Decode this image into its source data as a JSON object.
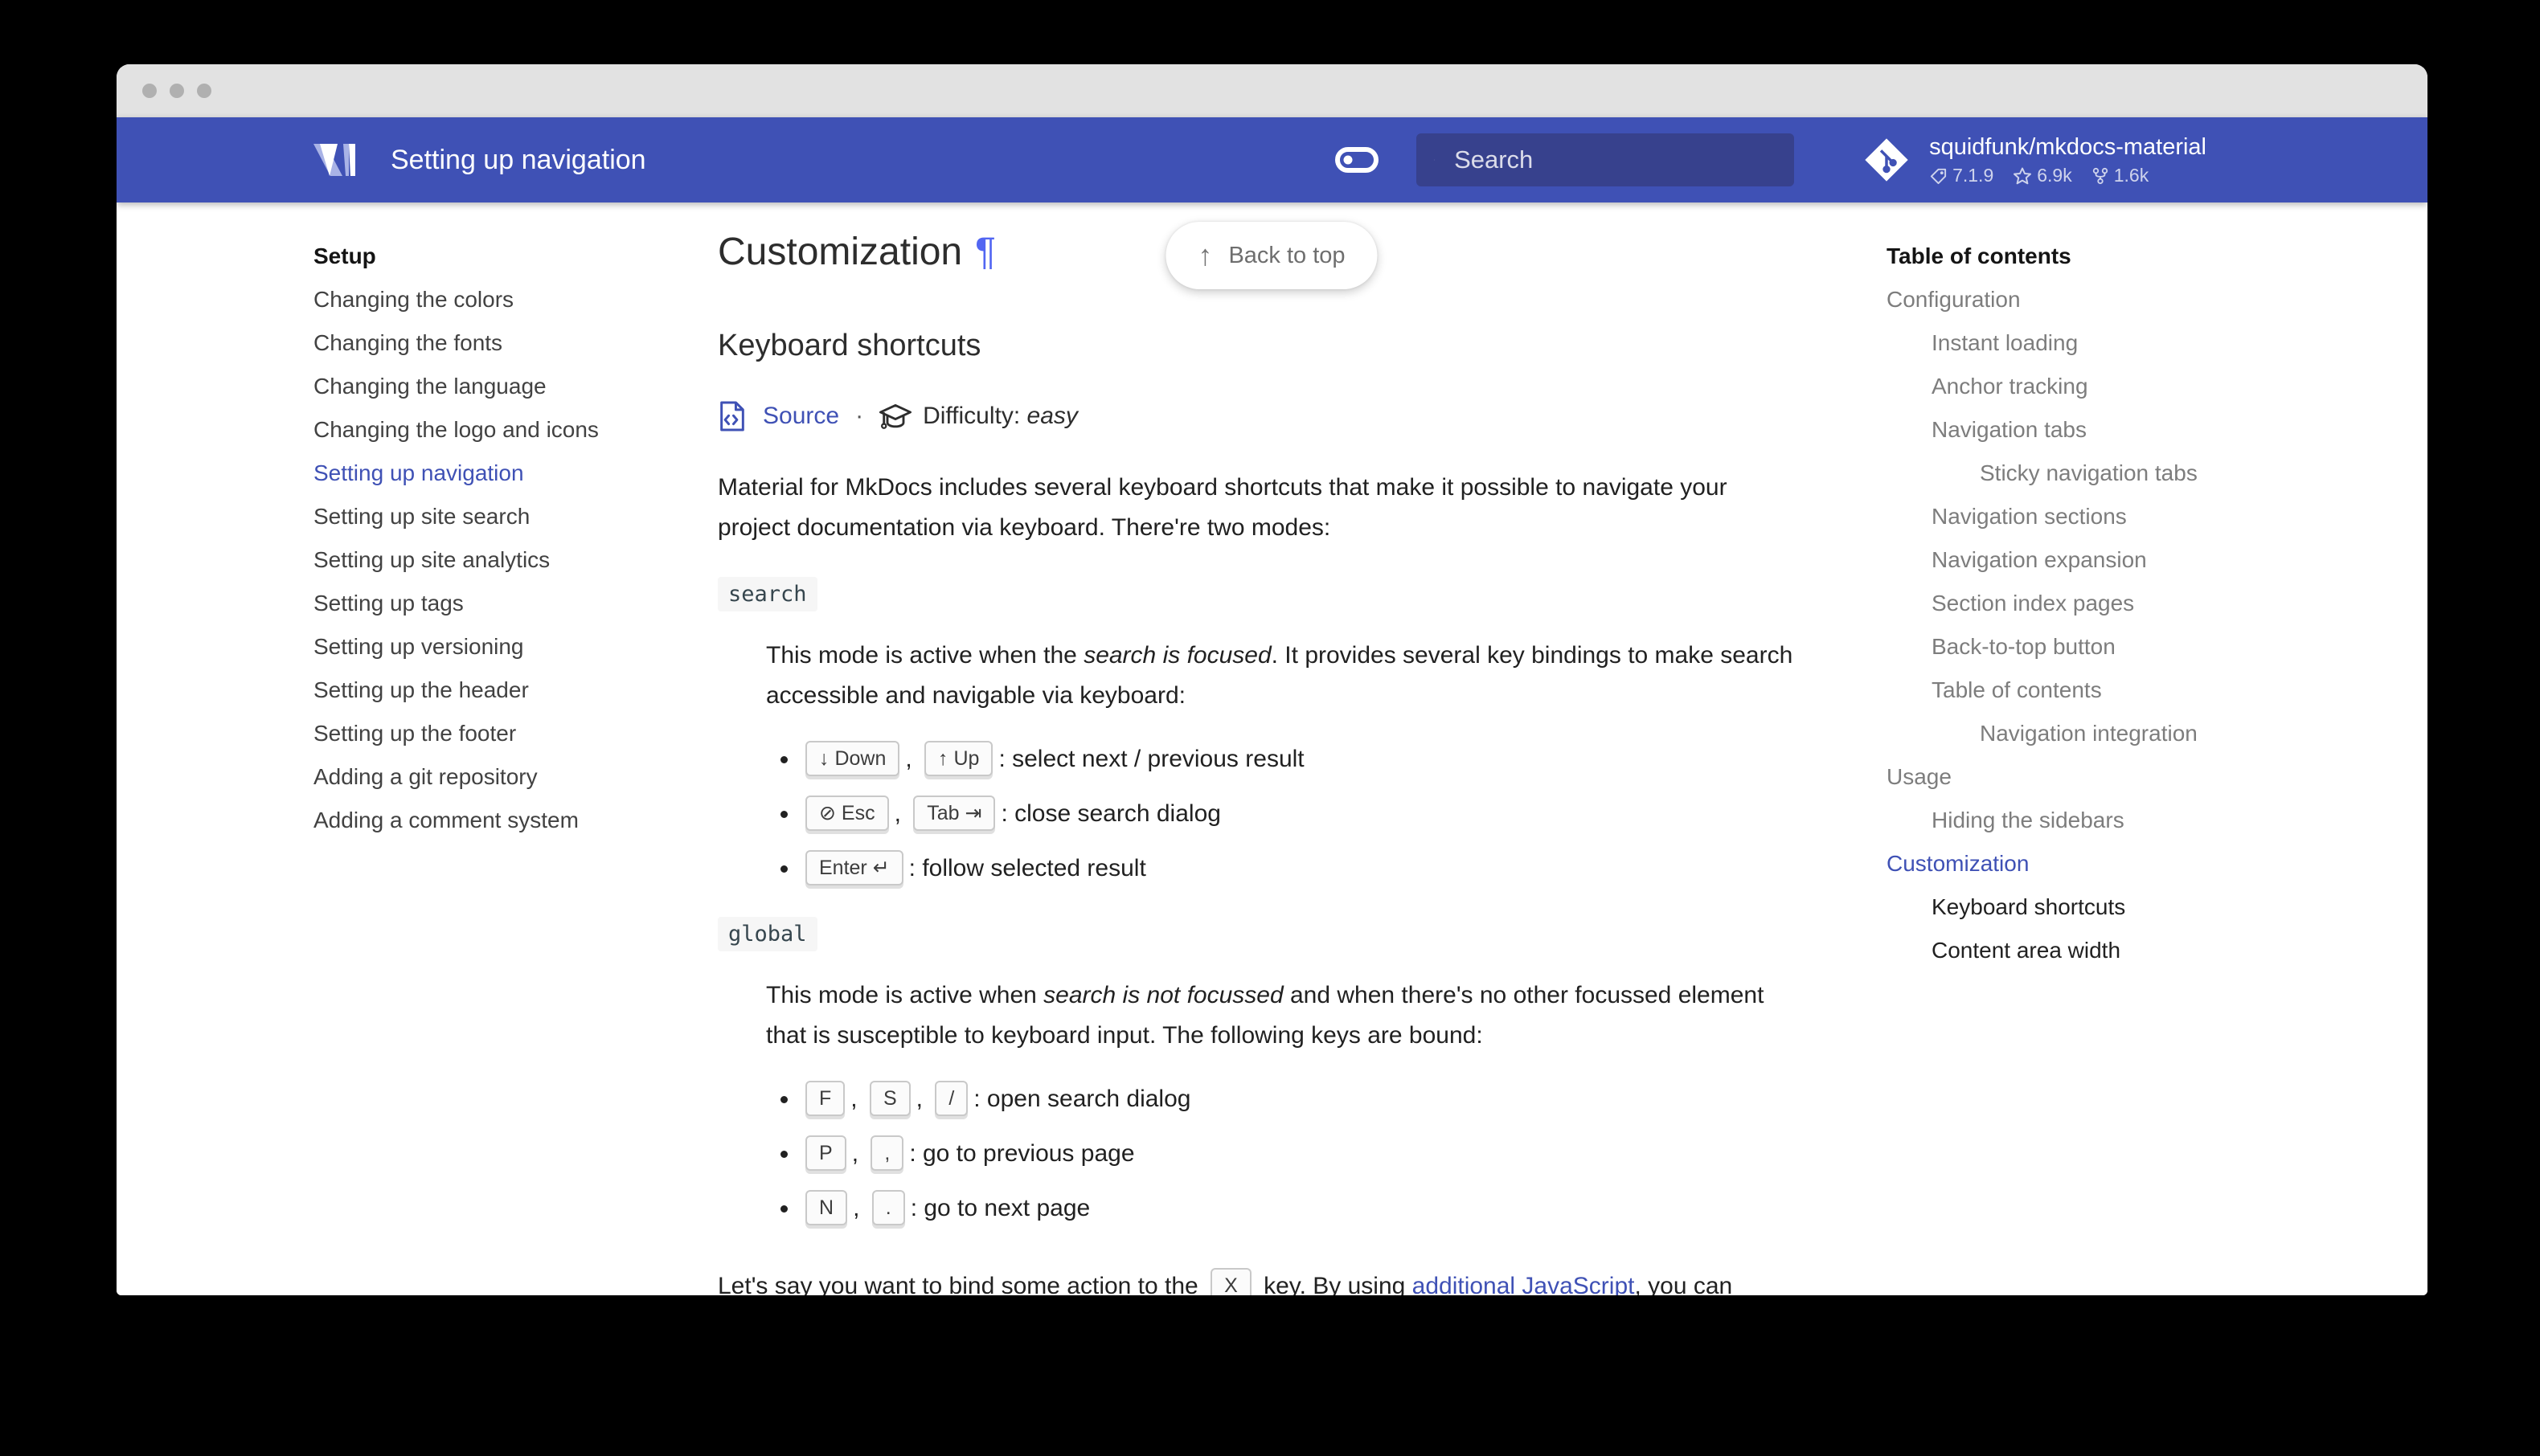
{
  "window": {
    "controls": [
      "dot",
      "dot",
      "dot"
    ]
  },
  "header": {
    "title": "Setting up navigation",
    "search": {
      "placeholder": "Search"
    },
    "repo": {
      "name": "squidfunk/mkdocs-material",
      "version": "7.1.9",
      "stars": "6.9k",
      "forks": "1.6k"
    }
  },
  "sidebar": {
    "section_label": "Setup",
    "items": [
      {
        "label": "Changing the colors",
        "active": false
      },
      {
        "label": "Changing the fonts",
        "active": false
      },
      {
        "label": "Changing the language",
        "active": false
      },
      {
        "label": "Changing the logo and icons",
        "active": false
      },
      {
        "label": "Setting up navigation",
        "active": true
      },
      {
        "label": "Setting up site search",
        "active": false
      },
      {
        "label": "Setting up site analytics",
        "active": false
      },
      {
        "label": "Setting up tags",
        "active": false
      },
      {
        "label": "Setting up versioning",
        "active": false
      },
      {
        "label": "Setting up the header",
        "active": false
      },
      {
        "label": "Setting up the footer",
        "active": false
      },
      {
        "label": "Adding a git repository",
        "active": false
      },
      {
        "label": "Adding a comment system",
        "active": false
      }
    ]
  },
  "toc": {
    "title": "Table of contents",
    "items": [
      {
        "label": "Configuration",
        "level": 0,
        "state": "normal"
      },
      {
        "label": "Instant loading",
        "level": 1,
        "state": "normal"
      },
      {
        "label": "Anchor tracking",
        "level": 1,
        "state": "normal"
      },
      {
        "label": "Navigation tabs",
        "level": 1,
        "state": "normal"
      },
      {
        "label": "Sticky navigation tabs",
        "level": 2,
        "state": "normal"
      },
      {
        "label": "Navigation sections",
        "level": 1,
        "state": "normal"
      },
      {
        "label": "Navigation expansion",
        "level": 1,
        "state": "normal"
      },
      {
        "label": "Section index pages",
        "level": 1,
        "state": "normal"
      },
      {
        "label": "Back-to-top button",
        "level": 1,
        "state": "normal"
      },
      {
        "label": "Table of contents",
        "level": 1,
        "state": "normal"
      },
      {
        "label": "Navigation integration",
        "level": 2,
        "state": "normal"
      },
      {
        "label": "Usage",
        "level": 0,
        "state": "normal"
      },
      {
        "label": "Hiding the sidebars",
        "level": 1,
        "state": "normal"
      },
      {
        "label": "Customization",
        "level": 0,
        "state": "active"
      },
      {
        "label": "Keyboard shortcuts",
        "level": 1,
        "state": "current"
      },
      {
        "label": "Content area width",
        "level": 1,
        "state": "current"
      }
    ]
  },
  "main": {
    "back_to_top": "Back to top",
    "back_to_top_arrow": "↑",
    "h1": "Customization",
    "pilcrow": "¶",
    "h2": "Keyboard shortcuts",
    "source_label": "Source",
    "separator": "·",
    "difficulty_label": "Difficulty: ",
    "difficulty_value": "easy",
    "intro": "Material for MkDocs includes several keyboard shortcuts that make it possible to navigate your project documentation via keyboard. There're two modes:",
    "modes": [
      {
        "chip": "search",
        "desc_pre": "This mode is active when the ",
        "desc_em": "search is focused",
        "desc_post": ". It provides several key bindings to make search accessible and navigable via keyboard:",
        "bindings": [
          {
            "keys": [
              "↓ Down",
              "↑ Up"
            ],
            "action": "select next / previous result"
          },
          {
            "keys": [
              "⊘ Esc",
              "Tab ⇥"
            ],
            "action": "close search dialog"
          },
          {
            "keys": [
              "Enter ↵"
            ],
            "action": "follow selected result"
          }
        ]
      },
      {
        "chip": "global",
        "desc_pre": "This mode is active when ",
        "desc_em": "search is not focussed",
        "desc_post": " and when there's no other focussed element that is susceptible to keyboard input. The following keys are bound:",
        "bindings": [
          {
            "keys": [
              "F",
              "S",
              "/"
            ],
            "action": "open search dialog"
          },
          {
            "keys": [
              "P",
              ","
            ],
            "action": "go to previous page"
          },
          {
            "keys": [
              "N",
              "."
            ],
            "action": "go to next page"
          }
        ]
      }
    ],
    "outro_pre": "Let's say you want to bind some action to the ",
    "outro_key": "X",
    "outro_mid": " key. By using ",
    "outro_link": "additional JavaScript",
    "outro_post": ", you can"
  },
  "colors": {
    "primary": "#3f51b5",
    "search_bg": "#37418d",
    "pilcrow": "#5266f2",
    "titlebar": "#e2e2e2",
    "toc_muted": "#7d7d7d",
    "text": "#212121"
  }
}
